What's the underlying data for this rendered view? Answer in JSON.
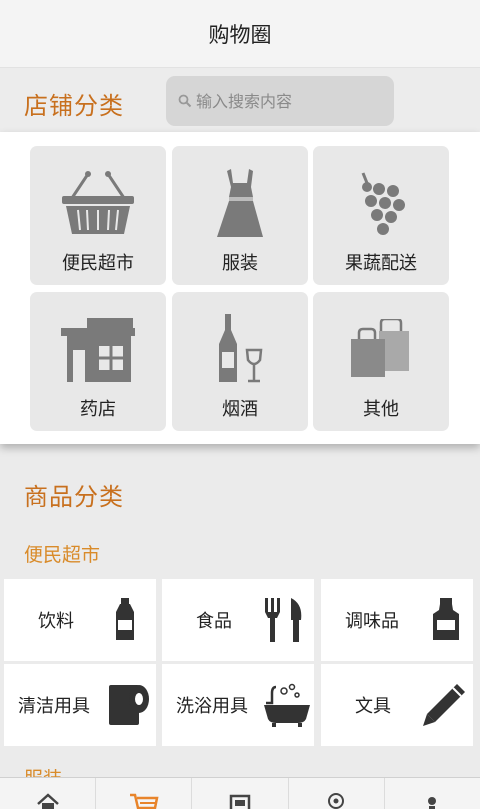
{
  "header": {
    "title": "购物圈"
  },
  "store_section": {
    "title": "店铺分类",
    "search_placeholder": "输入搜索内容",
    "categories": [
      {
        "label": "便民超市",
        "icon": "basket-icon"
      },
      {
        "label": "服装",
        "icon": "dress-icon"
      },
      {
        "label": "果蔬配送",
        "icon": "grapes-icon"
      },
      {
        "label": "药店",
        "icon": "building-icon"
      },
      {
        "label": "烟酒",
        "icon": "wine-icon"
      },
      {
        "label": "其他",
        "icon": "shopping-bags-icon"
      }
    ]
  },
  "goods_section": {
    "title": "商品分类",
    "subcategory": "便民超市",
    "items": [
      {
        "label": "饮料",
        "icon": "bottle-icon"
      },
      {
        "label": "食品",
        "icon": "fork-knife-icon"
      },
      {
        "label": "调味品",
        "icon": "jar-icon"
      },
      {
        "label": "清洁用具",
        "icon": "toilet-paper-icon"
      },
      {
        "label": "洗浴用具",
        "icon": "bathtub-icon"
      },
      {
        "label": "文具",
        "icon": "pen-icon"
      }
    ],
    "next_subcategory": "服装"
  },
  "bottom_nav": [
    {
      "icon": "home-icon"
    },
    {
      "icon": "cart-icon"
    },
    {
      "icon": "store-icon"
    },
    {
      "icon": "location-icon"
    },
    {
      "icon": "user-icon"
    }
  ],
  "colors": {
    "accent": "#c8701e",
    "sub_accent": "#d98b2a",
    "icon_gray": "#7a7a7a",
    "icon_dark": "#333333",
    "cart_orange": "#e8842a"
  }
}
